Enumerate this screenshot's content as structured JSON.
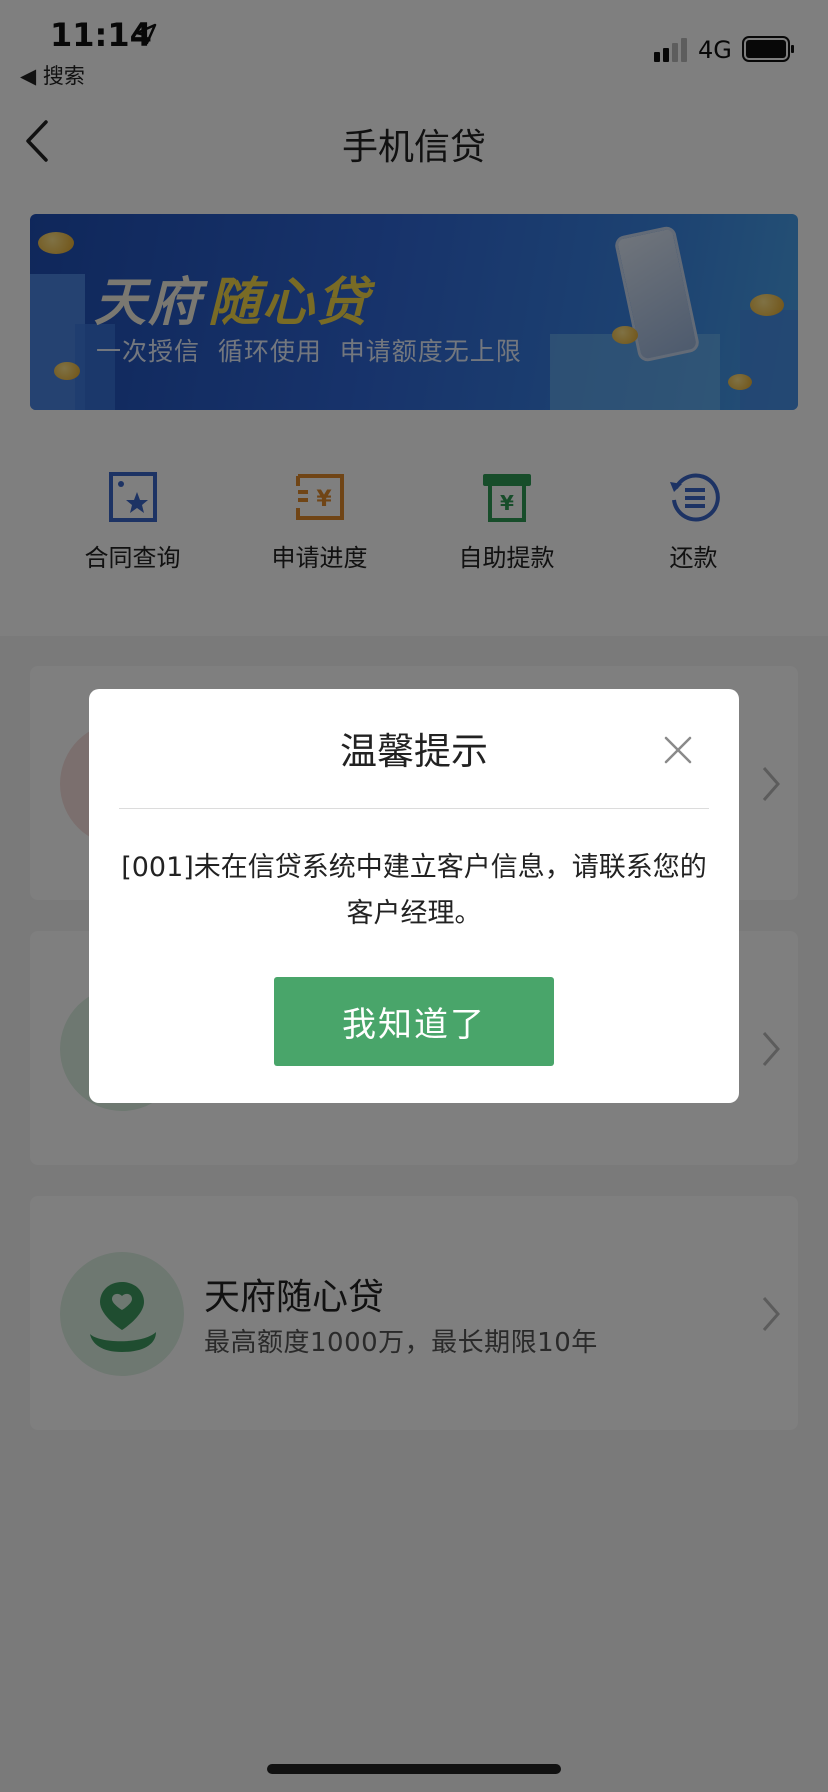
{
  "status_bar": {
    "time": "11:14",
    "back_app": "◀ 搜索",
    "network": "4G",
    "location_icon": "location-arrow-icon",
    "signal_icon": "signal-icon",
    "battery_icon": "battery-icon"
  },
  "nav": {
    "title": "手机信贷",
    "back_icon": "chevron-left-icon"
  },
  "banner": {
    "title_part1": "天府",
    "title_part2": "随心贷",
    "subtitle": "一次授信  循环使用  申请额度无上限"
  },
  "actions": [
    {
      "label": "合同查询",
      "icon": "contract-icon",
      "color": "#3b66c9"
    },
    {
      "label": "申请进度",
      "icon": "progress-icon",
      "color": "#e08a2c"
    },
    {
      "label": "自助提款",
      "icon": "withdraw-icon",
      "color": "#2f9a54"
    },
    {
      "label": "还款",
      "icon": "repay-icon",
      "color": "#3b66c9"
    }
  ],
  "cards": [
    {
      "title": "",
      "desc": "",
      "icon": "loan-product-icon"
    },
    {
      "title": "",
      "desc": "",
      "icon": "loan-product-icon"
    },
    {
      "title": "天府随心贷",
      "desc": "最高额度1000万，最长期限10年",
      "icon": "heart-hand-icon"
    }
  ],
  "dialog": {
    "title": "温馨提示",
    "message": "[001]未在信贷系统中建立客户信息，请联系您的客户经理。",
    "button": "我知道了",
    "close_icon": "close-icon"
  },
  "colors": {
    "brand_green": "#49a56a",
    "overlay": "rgba(0,0,0,0.5)"
  }
}
